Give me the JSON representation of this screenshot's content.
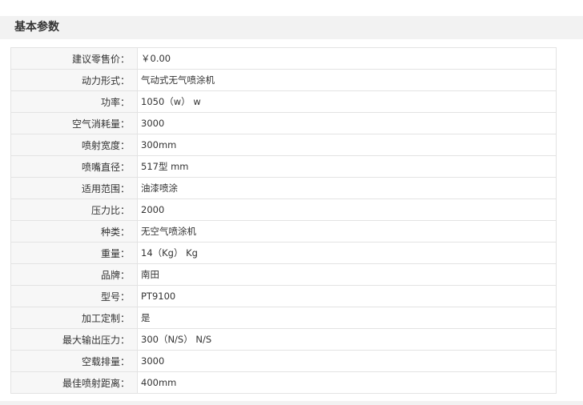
{
  "section": {
    "title": "基本参数"
  },
  "params": [
    {
      "label": "建议零售价：",
      "value": "￥0.00"
    },
    {
      "label": "动力形式：",
      "value": "气动式无气喷涂机"
    },
    {
      "label": "功率：",
      "value": "1050（w） w"
    },
    {
      "label": "空气消耗量：",
      "value": "3000"
    },
    {
      "label": "喷射宽度：",
      "value": "300mm"
    },
    {
      "label": "喷嘴直径：",
      "value": "517型 mm"
    },
    {
      "label": "适用范围：",
      "value": "油漆喷涂"
    },
    {
      "label": "压力比：",
      "value": "2000"
    },
    {
      "label": "种类：",
      "value": "无空气喷涂机"
    },
    {
      "label": "重量：",
      "value": "14（Kg） Kg"
    },
    {
      "label": "品牌：",
      "value": "南田"
    },
    {
      "label": "型号：",
      "value": "PT9100"
    },
    {
      "label": "加工定制：",
      "value": "是"
    },
    {
      "label": "最大输出压力：",
      "value": "300（N/S） N/S"
    },
    {
      "label": "空载排量：",
      "value": "3000"
    },
    {
      "label": "最佳喷射距离：",
      "value": "400mm"
    }
  ]
}
